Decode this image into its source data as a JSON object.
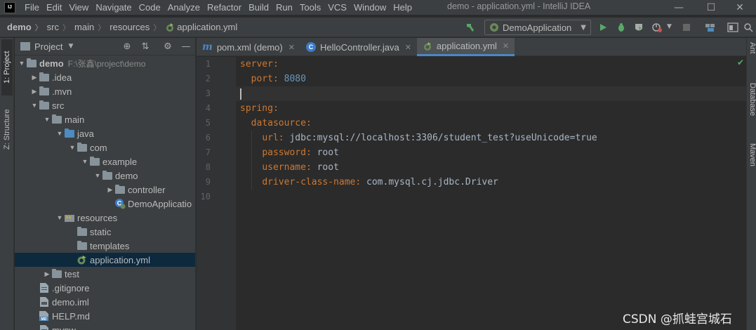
{
  "menubar": {
    "logo_text": "IJ",
    "items": [
      "File",
      "Edit",
      "View",
      "Navigate",
      "Code",
      "Analyze",
      "Refactor",
      "Build",
      "Run",
      "Tools",
      "VCS",
      "Window",
      "Help"
    ],
    "window_title": "demo - application.yml - IntelliJ IDEA",
    "minimize": "—",
    "maximize": "☐",
    "close": "✕"
  },
  "navbar": {
    "breadcrumbs": [
      "demo",
      "src",
      "main",
      "resources",
      "application.yml"
    ],
    "run_config": "DemoApplication"
  },
  "left_strip": {
    "tabs": [
      "1: Project",
      "Z: Structure"
    ]
  },
  "right_strip": {
    "tabs": [
      "Ant",
      "Database",
      "Maven"
    ]
  },
  "project_panel": {
    "title": "Project",
    "tree": [
      {
        "label": "demo",
        "sub": "F:\\张鑫\\project\\demo",
        "depth": 0,
        "expanded": true,
        "icon": "module-folder"
      },
      {
        "label": ".idea",
        "depth": 1,
        "expanded": false,
        "icon": "folder"
      },
      {
        "label": ".mvn",
        "depth": 1,
        "expanded": false,
        "icon": "folder"
      },
      {
        "label": "src",
        "depth": 1,
        "expanded": true,
        "icon": "folder"
      },
      {
        "label": "main",
        "depth": 2,
        "expanded": true,
        "icon": "folder"
      },
      {
        "label": "java",
        "depth": 3,
        "expanded": true,
        "icon": "source-folder"
      },
      {
        "label": "com",
        "depth": 4,
        "expanded": true,
        "icon": "package-folder"
      },
      {
        "label": "example",
        "depth": 5,
        "expanded": true,
        "icon": "package-folder"
      },
      {
        "label": "demo",
        "depth": 6,
        "expanded": true,
        "icon": "package-folder"
      },
      {
        "label": "controller",
        "depth": 7,
        "expanded": false,
        "icon": "package-folder"
      },
      {
        "label": "DemoApplicatio",
        "depth": 7,
        "leaf": true,
        "icon": "spring-class"
      },
      {
        "label": "resources",
        "depth": 3,
        "expanded": true,
        "icon": "resources-folder"
      },
      {
        "label": "static",
        "depth": 4,
        "leaf": true,
        "icon": "folder"
      },
      {
        "label": "templates",
        "depth": 4,
        "leaf": true,
        "icon": "folder"
      },
      {
        "label": "application.yml",
        "depth": 4,
        "leaf": true,
        "icon": "yml-file",
        "selected": true
      },
      {
        "label": "test",
        "depth": 2,
        "expanded": false,
        "icon": "folder"
      },
      {
        "label": ".gitignore",
        "depth": 1,
        "leaf": true,
        "icon": "text-file"
      },
      {
        "label": "demo.iml",
        "depth": 1,
        "leaf": true,
        "icon": "iml-file"
      },
      {
        "label": "HELP.md",
        "depth": 1,
        "leaf": true,
        "icon": "md-file"
      },
      {
        "label": "mvnw",
        "depth": 1,
        "leaf": true,
        "icon": "text-file"
      }
    ]
  },
  "editor_tabs": [
    {
      "label": "pom.xml (demo)",
      "icon": "maven-icon",
      "active": false
    },
    {
      "label": "HelloController.java",
      "icon": "class-icon",
      "active": false
    },
    {
      "label": "application.yml",
      "icon": "yml-icon",
      "active": true
    }
  ],
  "editor": {
    "line_numbers": [
      "1",
      "2",
      "3",
      "4",
      "5",
      "6",
      "7",
      "8",
      "9",
      "10"
    ],
    "lines": [
      {
        "indent": "",
        "key": "server",
        "value": ""
      },
      {
        "indent": "  ",
        "key": "port",
        "value": "8080",
        "value_type": "number"
      },
      {
        "indent": "",
        "key": "",
        "value": "",
        "caret": true
      },
      {
        "indent": "",
        "key": "spring",
        "value": ""
      },
      {
        "indent": "  ",
        "key": "datasource",
        "value": ""
      },
      {
        "indent": "    ",
        "key": "url",
        "value": "jdbc:mysql://localhost:3306/student_test?useUnicode=true"
      },
      {
        "indent": "    ",
        "key": "password",
        "value": "root"
      },
      {
        "indent": "    ",
        "key": "username",
        "value": "root"
      },
      {
        "indent": "    ",
        "key": "driver-class-name",
        "value": "com.mysql.cj.jdbc.Driver"
      },
      {
        "indent": "",
        "key": "",
        "value": ""
      }
    ],
    "current_line": 3
  },
  "watermark": "CSDN @抓蛙宫城石",
  "colors": {
    "key": "#cc7832",
    "value": "#a9b7c6",
    "number": "#6897bb",
    "selection": "#0d293e",
    "accent": "#4a88c7"
  }
}
